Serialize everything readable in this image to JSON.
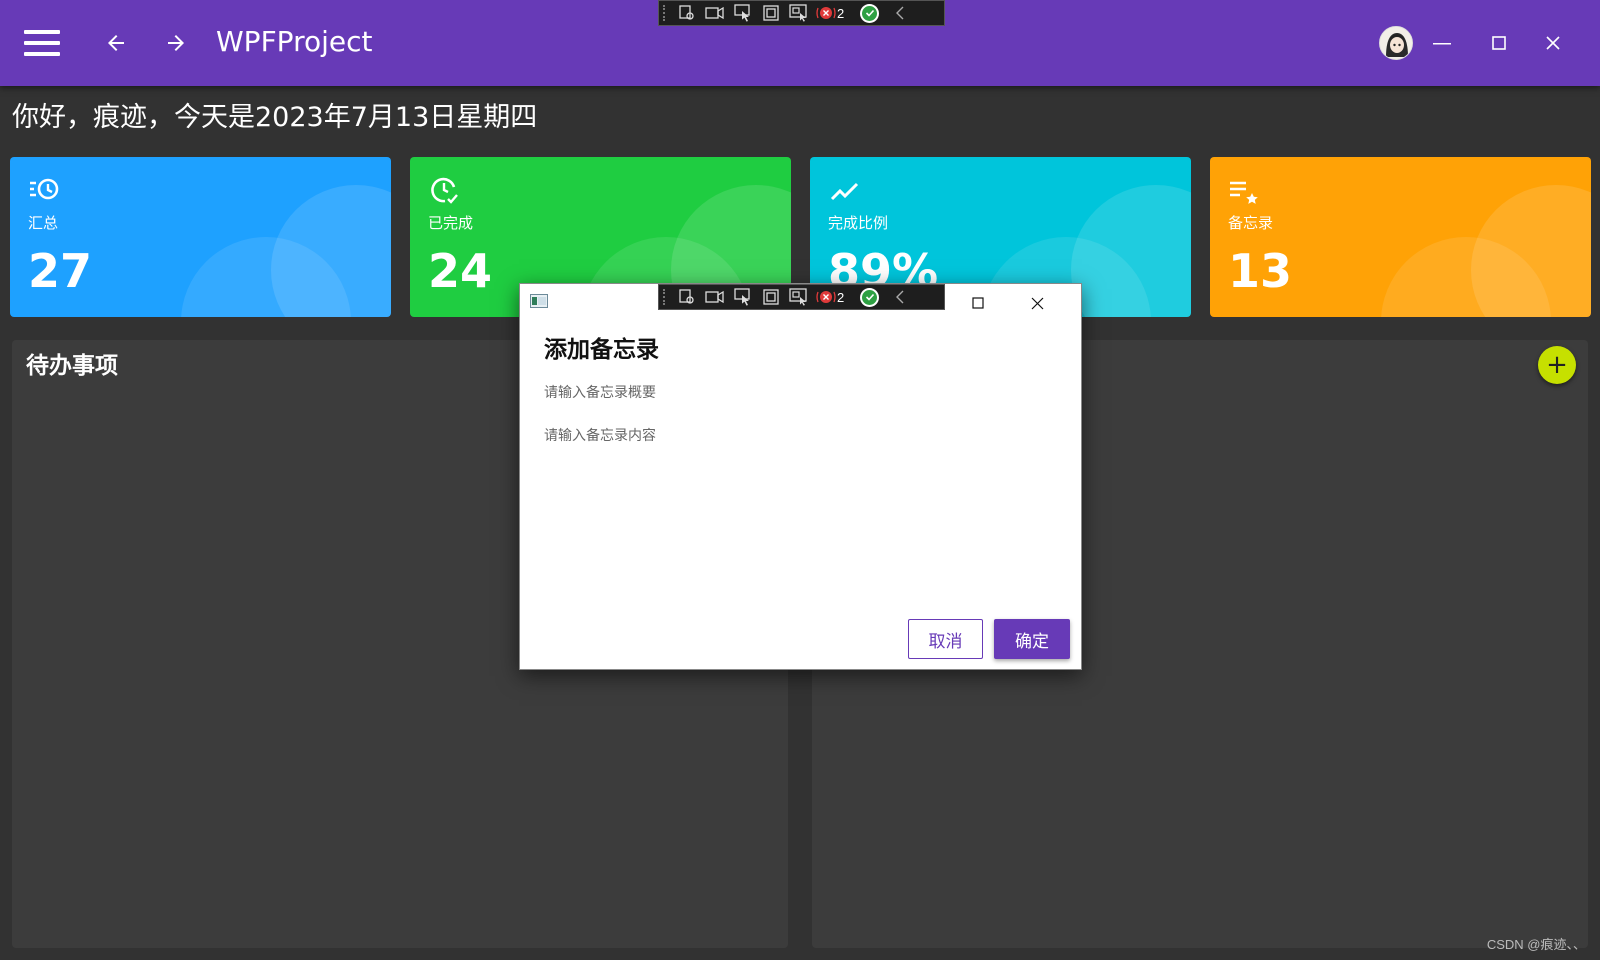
{
  "window": {
    "title": "WPFProject"
  },
  "greeting": "你好，痕迹，今天是2023年7月13日星期四",
  "cards": [
    {
      "title": "汇总",
      "value": "27",
      "color": "#1ea1ff",
      "icon": "clock-list-icon"
    },
    {
      "title": "已完成",
      "value": "24",
      "color": "#1fcd41",
      "icon": "clock-check-icon"
    },
    {
      "title": "完成比例",
      "value": "89%",
      "color": "#00c5db",
      "icon": "trending-up-icon"
    },
    {
      "title": "备忘录",
      "value": "13",
      "color": "#ffa206",
      "icon": "playlist-star-icon"
    }
  ],
  "panels": {
    "todo_title": "待办事项",
    "memo_title": "",
    "add_label": "+"
  },
  "dialog": {
    "heading": "添加备忘录",
    "summary_placeholder": "请输入备忘录概要",
    "content_placeholder": "请输入备忘录内容",
    "cancel_label": "取消",
    "ok_label": "确定"
  },
  "debug_toolbar": {
    "count": "2"
  },
  "watermark": "CSDN @痕迹、、"
}
